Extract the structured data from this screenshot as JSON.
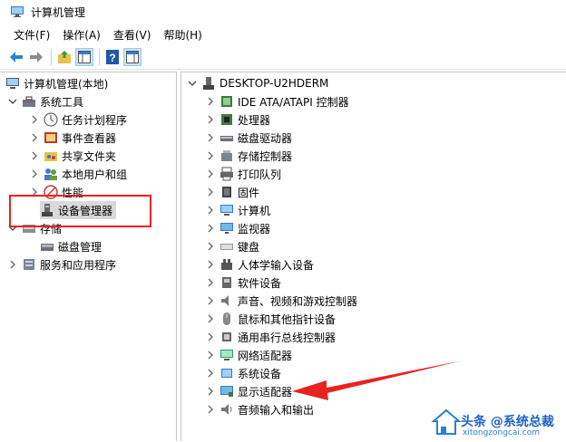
{
  "window": {
    "title": "计算机管理"
  },
  "menu": [
    "文件(F)",
    "操作(A)",
    "查看(V)",
    "帮助(H)"
  ],
  "left_tree": {
    "root": "计算机管理(本地)",
    "system_tools": "系统工具",
    "items": [
      "任务计划程序",
      "事件查看器",
      "共享文件夹",
      "本地用户和组",
      "性能",
      "设备管理器"
    ],
    "storage": "存储",
    "disk_management": "磁盘管理",
    "services": "服务和应用程序"
  },
  "right_tree": {
    "root": "DESKTOP-U2HDERM",
    "categories": [
      "IDE ATA/ATAPI 控制器",
      "处理器",
      "磁盘驱动器",
      "存储控制器",
      "打印队列",
      "固件",
      "计算机",
      "监视器",
      "键盘",
      "人体学输入设备",
      "软件设备",
      "声音、视频和游戏控制器",
      "鼠标和其他指针设备",
      "通用串行总线控制器",
      "网络适配器",
      "系统设备",
      "显示适配器",
      "音频输入和输出"
    ]
  },
  "annotation": {
    "highlight_color": "#e8231f",
    "arrow_color": "#e8231f"
  },
  "watermark": {
    "text": "头条 @系统总裁",
    "url": "xitongzongcai.com"
  }
}
